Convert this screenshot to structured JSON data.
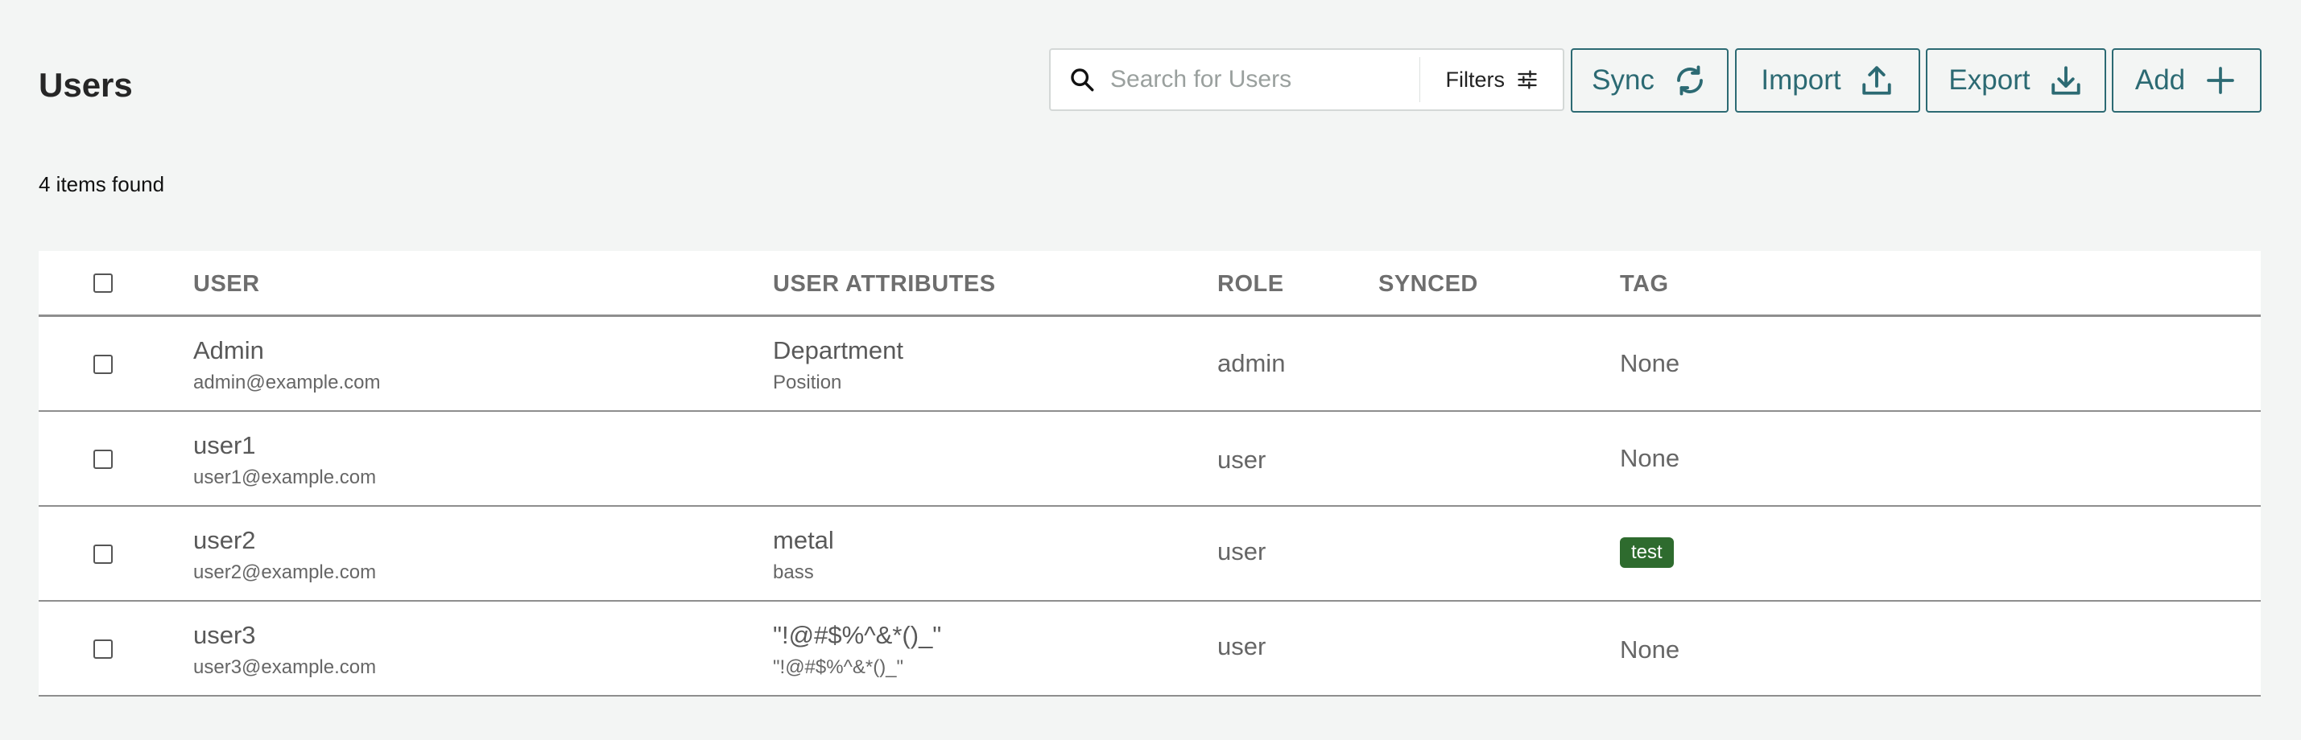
{
  "page": {
    "title": "Users",
    "count_text": "4 items found"
  },
  "toolbar": {
    "search_placeholder": "Search for Users",
    "search_value": "",
    "filters_label": "Filters",
    "sync_label": "Sync",
    "import_label": "Import",
    "export_label": "Export",
    "add_label": "Add"
  },
  "table": {
    "headers": {
      "user": "USER",
      "user_attributes": "USER ATTRIBUTES",
      "role": "ROLE",
      "synced": "SYNCED",
      "tag": "TAG"
    },
    "rows": [
      {
        "name": "Admin",
        "email": "admin@example.com",
        "attr_primary": "Department",
        "attr_secondary": "Position",
        "role": "admin",
        "synced": "",
        "tag": "None",
        "tag_is_badge": false
      },
      {
        "name": "user1",
        "email": "user1@example.com",
        "attr_primary": "",
        "attr_secondary": "",
        "role": "user",
        "synced": "",
        "tag": "None",
        "tag_is_badge": false
      },
      {
        "name": "user2",
        "email": "user2@example.com",
        "attr_primary": "metal",
        "attr_secondary": "bass",
        "role": "user",
        "synced": "",
        "tag": "test",
        "tag_is_badge": true
      },
      {
        "name": "user3",
        "email": "user3@example.com",
        "attr_primary": "\"!@#$%^&*()_\"",
        "attr_secondary": "\"!@#$%^&*()_\"",
        "role": "user",
        "synced": "",
        "tag": "None",
        "tag_is_badge": false
      }
    ]
  },
  "colors": {
    "accent": "#2c6a73",
    "tag_badge": "#2e6b2e",
    "page_background": "#f3f5f4"
  },
  "icons": {
    "search": "search-icon",
    "filters": "sliders-icon",
    "sync": "sync-icon",
    "import": "upload-icon",
    "export": "download-icon",
    "add": "plus-icon"
  }
}
